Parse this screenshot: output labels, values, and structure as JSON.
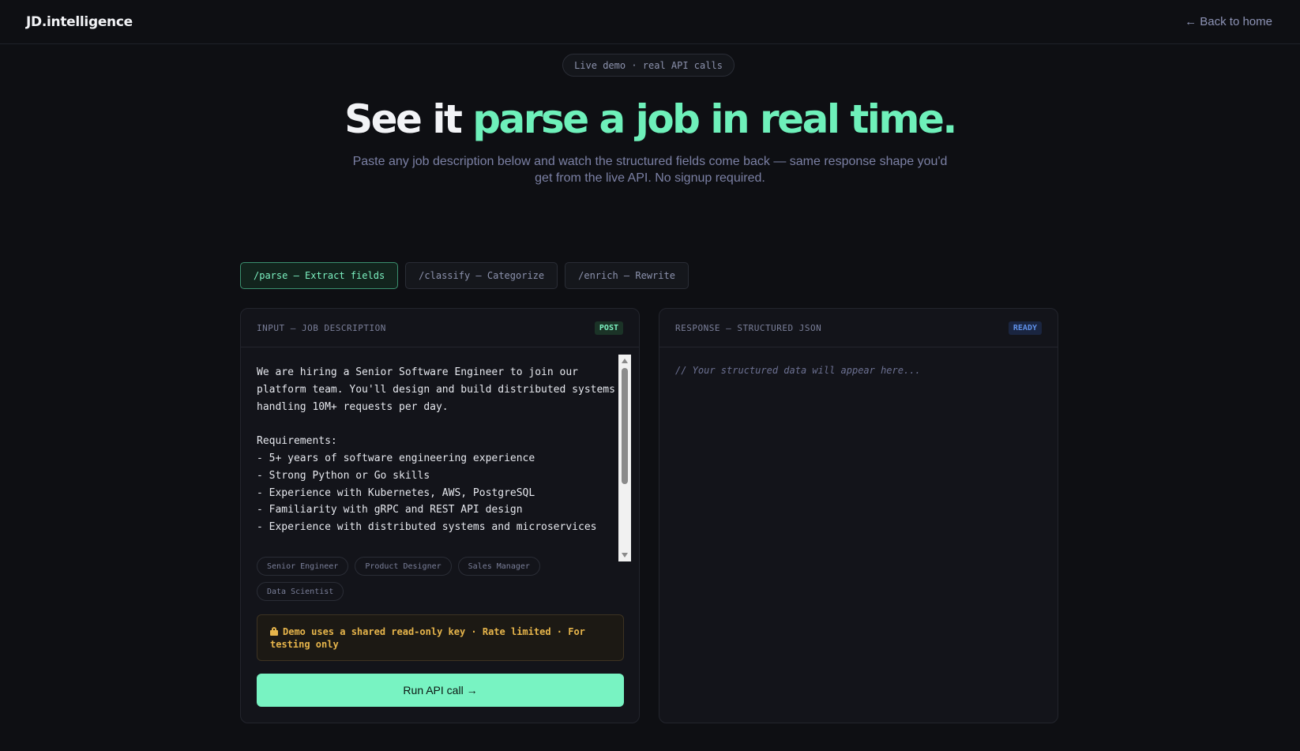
{
  "header": {
    "logo": "JD.intelligence",
    "back_link": "← Back to home"
  },
  "hero": {
    "pill": "Live demo · real API calls",
    "headline_white": "See it ",
    "headline_accent": "parse a job in real time.",
    "subtitle": "Paste any job description below and watch the structured fields come back — same response shape you'd get from the live API. No signup required."
  },
  "tabs": [
    {
      "label": "/parse — Extract fields",
      "active": true
    },
    {
      "label": "/classify — Categorize",
      "active": false
    },
    {
      "label": "/enrich — Rewrite",
      "active": false
    }
  ],
  "input_panel": {
    "title": "INPUT — JOB DESCRIPTION",
    "method_badge": "POST",
    "job_text": "We are hiring a Senior Software Engineer to join our platform team. You'll design and build distributed systems handling 10M+ requests per day.\n\nRequirements:\n- 5+ years of software engineering experience\n- Strong Python or Go skills\n- Experience with Kubernetes, AWS, PostgreSQL\n- Familiarity with gRPC and REST API design\n- Experience with distributed systems and microservices",
    "sample_chips": [
      "Senior Engineer",
      "Product Designer",
      "Sales Manager",
      "Data Scientist"
    ],
    "notice": "Demo uses a shared read-only key · Rate limited · For testing only",
    "notice_icon": "lock-icon",
    "run_button": "Run API call →"
  },
  "output_panel": {
    "title": "RESPONSE — STRUCTURED JSON",
    "status_badge": "READY",
    "placeholder": "// Your structured data will appear here..."
  },
  "colors": {
    "background": "#0e0f13",
    "accent": "#6ef0ba",
    "button": "#78f3c2",
    "warning": "#e7b54b",
    "ready": "#5e8fe6"
  }
}
